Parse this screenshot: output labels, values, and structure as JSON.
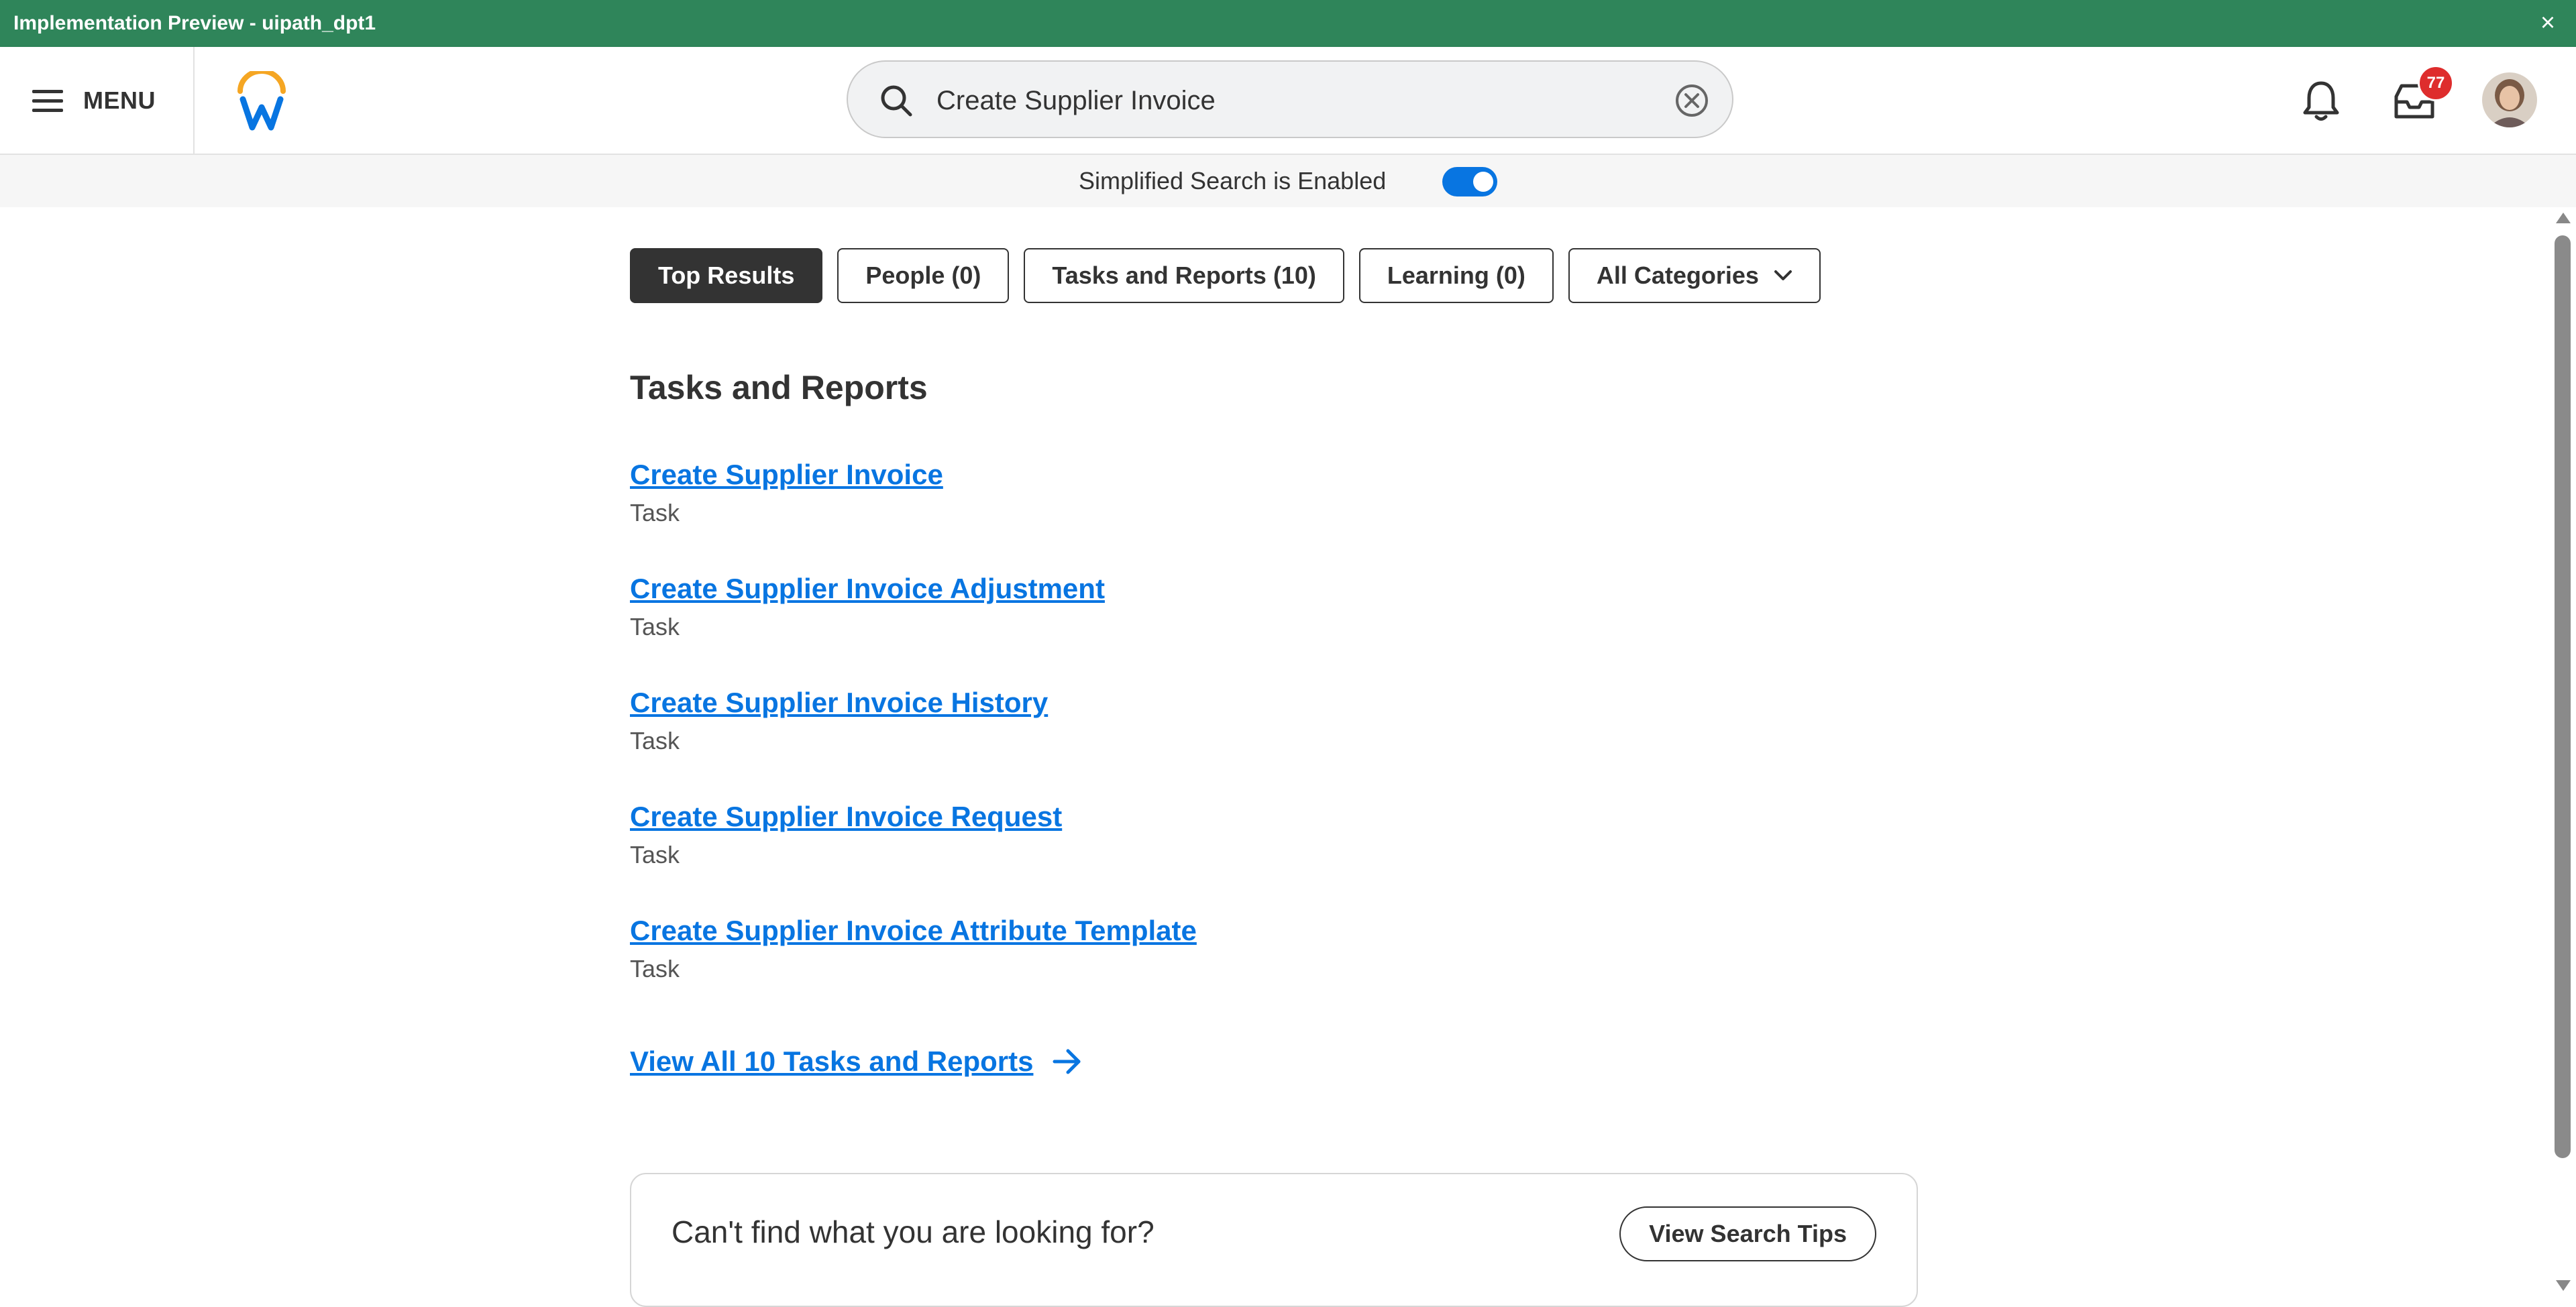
{
  "env_bar": {
    "title": "Implementation Preview -  uipath_dpt1",
    "close_glyph": "×"
  },
  "header": {
    "menu_label": "MENU",
    "search_value": "Create Supplier Invoice",
    "inbox_badge": "77",
    "icons": [
      "hamburger-icon",
      "workday-logo",
      "search-icon",
      "clear-icon",
      "bell-icon",
      "inbox-icon",
      "avatar"
    ]
  },
  "simplified_search": {
    "label": "Simplified Search is Enabled",
    "enabled": true
  },
  "filters": {
    "tabs": [
      {
        "label": "Top Results",
        "active": true
      },
      {
        "label": "People (0)",
        "active": false
      },
      {
        "label": "Tasks and Reports (10)",
        "active": false
      },
      {
        "label": "Learning (0)",
        "active": false
      },
      {
        "label": "All Categories",
        "active": false
      }
    ]
  },
  "results": {
    "section_title": "Tasks and Reports",
    "items": [
      {
        "title": "Create Supplier Invoice",
        "type": "Task"
      },
      {
        "title": "Create Supplier Invoice Adjustment",
        "type": "Task"
      },
      {
        "title": "Create Supplier Invoice History",
        "type": "Task"
      },
      {
        "title": "Create Supplier Invoice Request",
        "type": "Task"
      },
      {
        "title": "Create Supplier Invoice Attribute Template",
        "type": "Task"
      }
    ],
    "view_all": "View All 10 Tasks and Reports"
  },
  "help": {
    "question": "Can't find what you are looking for?",
    "button": "View Search Tips"
  },
  "colors": {
    "env_bar": "#2f855a",
    "link": "#0875e1",
    "toggle": "#0875e1",
    "badge": "#de2d2d",
    "active_tab": "#333333",
    "logo_arc": "#f5a623",
    "logo_w": "#0875e1"
  }
}
